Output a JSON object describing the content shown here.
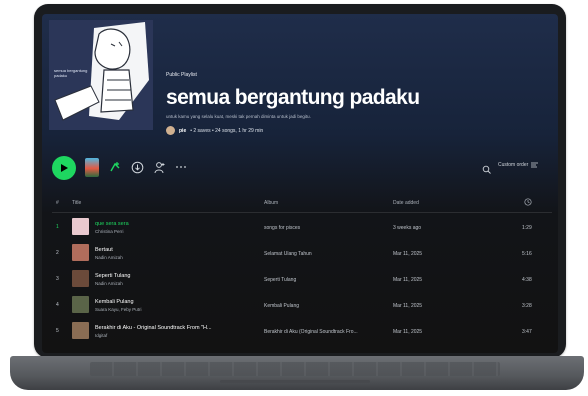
{
  "playlist": {
    "type_label": "Public Playlist",
    "title": "semua bergantung padaku",
    "description": "untuk kamu yang selalu kuat, meski tak pernah diminta untuk jadi begitu.",
    "owner": "pie",
    "stats": "• 2 saves • 24 songs, 1 hr 29 min",
    "cover_text": "semua bergantung padaku"
  },
  "toolbar": {
    "sort_label": "Custom order"
  },
  "table": {
    "headers": {
      "num": "#",
      "title": "Title",
      "album": "Album",
      "date": "Date added"
    },
    "rows": [
      {
        "num": "1",
        "title": "que sera sera",
        "artist": "Christina Perri",
        "album": "songs for pisces",
        "date": "3 weeks ago",
        "duration": "1:29",
        "thumb_color": "#e9c9cf"
      },
      {
        "num": "2",
        "title": "Bertaut",
        "artist": "Nadin Amizah",
        "album": "Selamat Ulang Tahun",
        "date": "Mar 11, 2025",
        "duration": "5:16",
        "thumb_color": "#b06d5c"
      },
      {
        "num": "3",
        "title": "Seperti Tulang",
        "artist": "Nadin Amizah",
        "album": "Seperti Tulang",
        "date": "Mar 11, 2025",
        "duration": "4:38",
        "thumb_color": "#6b4a3a"
      },
      {
        "num": "4",
        "title": "Kembali Pulang",
        "artist": "Suara Kayu, Feby Putri",
        "album": "Kembali Pulang",
        "date": "Mar 11, 2025",
        "duration": "3:28",
        "thumb_color": "#5a6448"
      },
      {
        "num": "5",
        "title": "Berakhir di Aku - Original Soundtrack From \"H...",
        "artist": "Idgitaf",
        "album": "Berakhir di Aku (Original Soundtrack Fro...",
        "date": "Mar 11, 2025",
        "duration": "3:47",
        "thumb_color": "#8a6d54"
      }
    ]
  },
  "colors": {
    "accent": "#1ed760",
    "header_bg": "#1f2d4a",
    "body_bg": "#121212"
  },
  "icons": [
    "play-icon",
    "add-to-library-icon",
    "download-icon",
    "add-user-icon",
    "more-icon",
    "search-icon",
    "list-icon",
    "clock-icon"
  ]
}
